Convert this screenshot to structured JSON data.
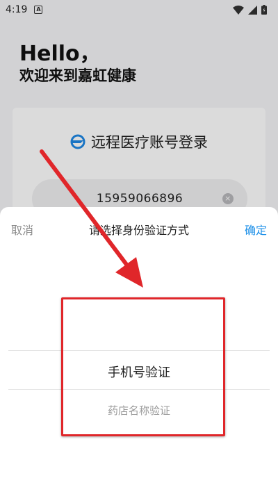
{
  "status_bar": {
    "time": "4:19",
    "notification_badge": "A",
    "icons": [
      "wifi-icon",
      "signal-icon",
      "battery-icon"
    ]
  },
  "background": {
    "hello": "Hello，",
    "welcome": "欢迎来到嘉虹健康",
    "card_title": "远程医疗账号登录",
    "phone_number": "15959066896"
  },
  "picker": {
    "cancel_label": "取消",
    "title": "请选择身份验证方式",
    "confirm_label": "确定",
    "options": [
      "手机号验证",
      "药店名称验证"
    ],
    "selected_index": 0
  },
  "colors": {
    "accent": "#1e90e8",
    "annotation_red": "#e0262a",
    "logo_blue": "#1e88e5"
  }
}
